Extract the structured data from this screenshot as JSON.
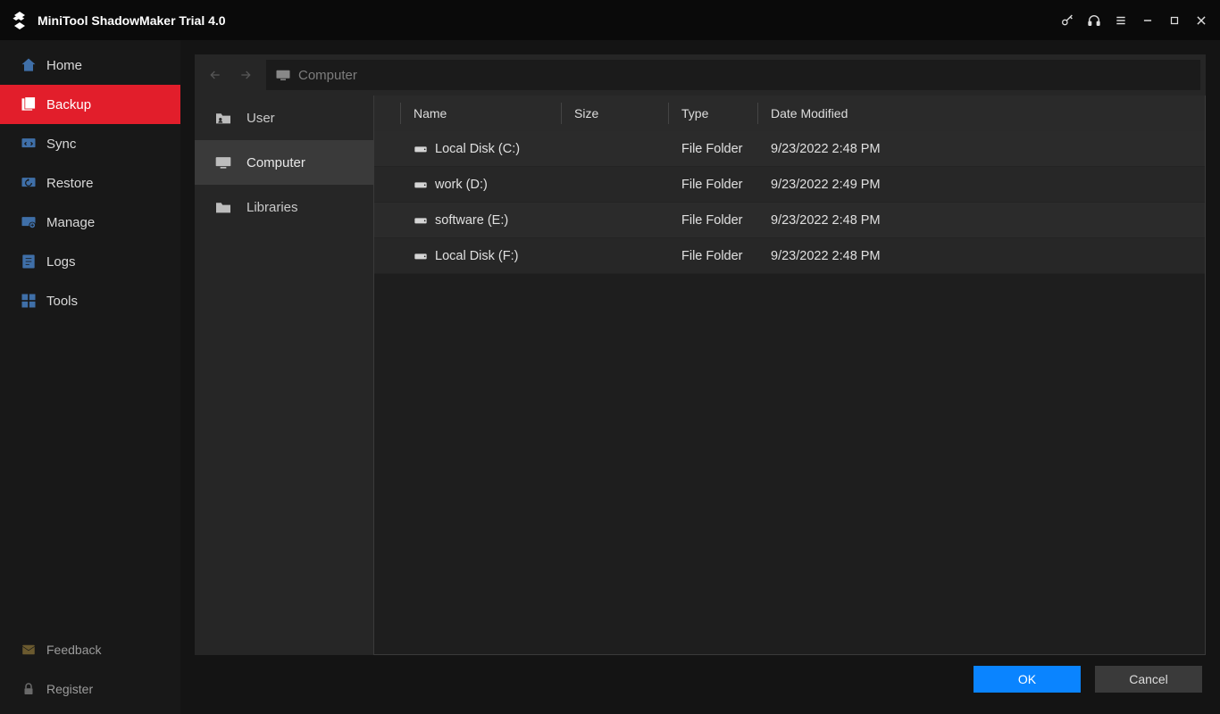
{
  "titlebar": {
    "app_title": "MiniTool ShadowMaker Trial 4.0"
  },
  "sidebar": {
    "items": [
      {
        "id": "home",
        "label": "Home",
        "icon": "home-icon"
      },
      {
        "id": "backup",
        "label": "Backup",
        "icon": "backup-icon",
        "active": true
      },
      {
        "id": "sync",
        "label": "Sync",
        "icon": "sync-icon"
      },
      {
        "id": "restore",
        "label": "Restore",
        "icon": "restore-icon"
      },
      {
        "id": "manage",
        "label": "Manage",
        "icon": "manage-icon"
      },
      {
        "id": "logs",
        "label": "Logs",
        "icon": "logs-icon"
      },
      {
        "id": "tools",
        "label": "Tools",
        "icon": "tools-icon"
      }
    ],
    "bottom": [
      {
        "id": "feedback",
        "label": "Feedback",
        "icon": "feedback-icon"
      },
      {
        "id": "register",
        "label": "Register",
        "icon": "register-icon"
      }
    ]
  },
  "pathbar": {
    "location": "Computer"
  },
  "tree": {
    "items": [
      {
        "id": "user",
        "label": "User",
        "icon": "user-folder-icon"
      },
      {
        "id": "computer",
        "label": "Computer",
        "icon": "computer-icon",
        "selected": true
      },
      {
        "id": "libraries",
        "label": "Libraries",
        "icon": "libraries-icon"
      }
    ]
  },
  "columns": {
    "name": "Name",
    "size": "Size",
    "type": "Type",
    "date": "Date Modified"
  },
  "rows": [
    {
      "name": "Local Disk (C:)",
      "size": "",
      "type": "File Folder",
      "date": "9/23/2022 2:48 PM"
    },
    {
      "name": "work (D:)",
      "size": "",
      "type": "File Folder",
      "date": "9/23/2022 2:49 PM"
    },
    {
      "name": "software (E:)",
      "size": "",
      "type": "File Folder",
      "date": "9/23/2022 2:48 PM"
    },
    {
      "name": "Local Disk (F:)",
      "size": "",
      "type": "File Folder",
      "date": "9/23/2022 2:48 PM"
    }
  ],
  "footer": {
    "ok": "OK",
    "cancel": "Cancel"
  }
}
